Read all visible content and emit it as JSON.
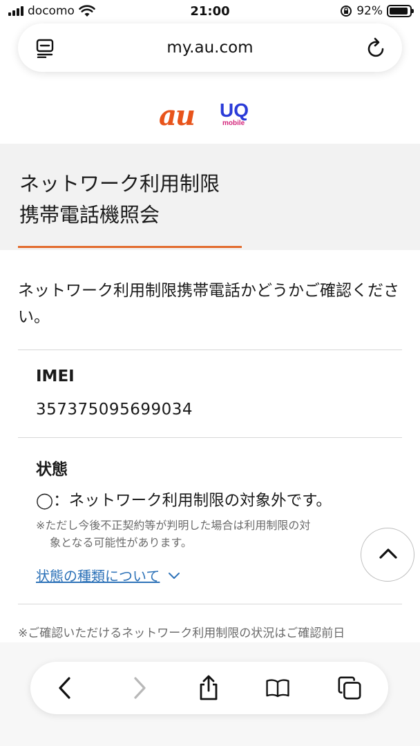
{
  "status_bar": {
    "carrier": "docomo",
    "time": "21:00",
    "battery_percent": "92%",
    "battery_level": 0.92,
    "icons": [
      "signal-icon",
      "wifi-icon",
      "orientation-lock-icon",
      "battery-icon"
    ]
  },
  "browser": {
    "url": "my.au.com",
    "icons": [
      "reader-icon",
      "reload-icon"
    ]
  },
  "logos": {
    "au": "au",
    "uq": "UQ",
    "uq_sub": "mobile",
    "au_color": "#e8541b",
    "uq_color": "#2a3bd8",
    "mobile_color": "#d3257a"
  },
  "page": {
    "title_line1": "ネットワーク利用制限",
    "title_line2": "携帯電話機照会",
    "accent_color": "#e26a2c",
    "intro": "ネットワーク利用制限携帯電話かどうかご確認ください。",
    "imei_label": "IMEI",
    "imei_value": "357375095699034",
    "status_label": "状態",
    "status_value": "◯：ネットワーク利用制限の対象外です。",
    "status_note_line1": "※ただし今後不正契約等が判明した場合は利用制限の対",
    "status_note_line2": "象となる可能性があります。",
    "status_link": "状態の種類について",
    "bottom_note": "※ご確認いただけるネットワーク利用制限の状況はご確認前日"
  },
  "toolbar": {
    "icons": [
      "back-icon",
      "forward-icon",
      "share-icon",
      "bookmarks-icon",
      "tabs-icon"
    ]
  }
}
